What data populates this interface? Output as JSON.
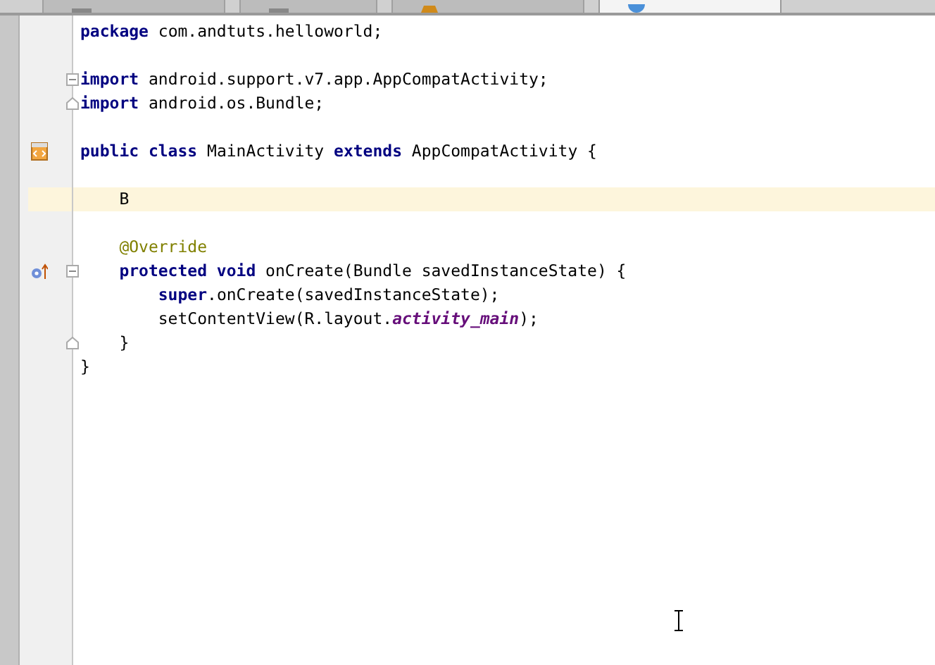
{
  "tabs": [
    {
      "selected": false
    },
    {
      "selected": false
    },
    {
      "selected": false
    },
    {
      "selected": true
    }
  ],
  "lines": [
    {
      "tokens": [
        {
          "kind": "keyword",
          "text": "package"
        },
        {
          "kind": "plain",
          "text": " com.andtuts.helloworld;"
        }
      ]
    },
    {
      "blank_line_before": true,
      "fold_start": true,
      "tokens": [
        {
          "kind": "keyword",
          "text": "import"
        },
        {
          "kind": "plain",
          "text": " android.support.v7.app.AppCompatActivity;"
        }
      ]
    },
    {
      "fold_end": true,
      "tokens": [
        {
          "kind": "keyword",
          "text": "import"
        },
        {
          "kind": "plain",
          "text": " android.os.Bundle;"
        }
      ]
    },
    {
      "blank_line_before": true,
      "layout_link": true,
      "tokens": [
        {
          "kind": "keyword",
          "text": "public class"
        },
        {
          "kind": "plain",
          "text": " MainActivity "
        },
        {
          "kind": "keyword",
          "text": "extends"
        },
        {
          "kind": "plain",
          "text": " AppCompatActivity {"
        }
      ]
    },
    {
      "blank_line_before": true,
      "current": true,
      "tokens": [
        {
          "kind": "plain",
          "text": "    B"
        }
      ]
    },
    {
      "blank_line_before": true,
      "tokens": [
        {
          "kind": "annotation",
          "text": "    @Override"
        }
      ]
    },
    {
      "fold_start": true,
      "overrides": true,
      "tokens": [
        {
          "kind": "keyword",
          "text": "    protected void"
        },
        {
          "kind": "plain",
          "text": " onCreate(Bundle savedInstanceState) {"
        }
      ]
    },
    {
      "tokens": [
        {
          "kind": "keyword",
          "text": "        super"
        },
        {
          "kind": "plain",
          "text": ".onCreate(savedInstanceState);"
        }
      ]
    },
    {
      "tokens": [
        {
          "kind": "plain",
          "text": "        setContentView(R.layout."
        },
        {
          "kind": "field",
          "text": "activity_main"
        },
        {
          "kind": "plain",
          "text": ");"
        }
      ]
    },
    {
      "fold_end": true,
      "tokens": [
        {
          "kind": "plain",
          "text": "    }"
        }
      ]
    },
    {
      "tokens": [
        {
          "kind": "plain",
          "text": "}"
        }
      ]
    }
  ]
}
